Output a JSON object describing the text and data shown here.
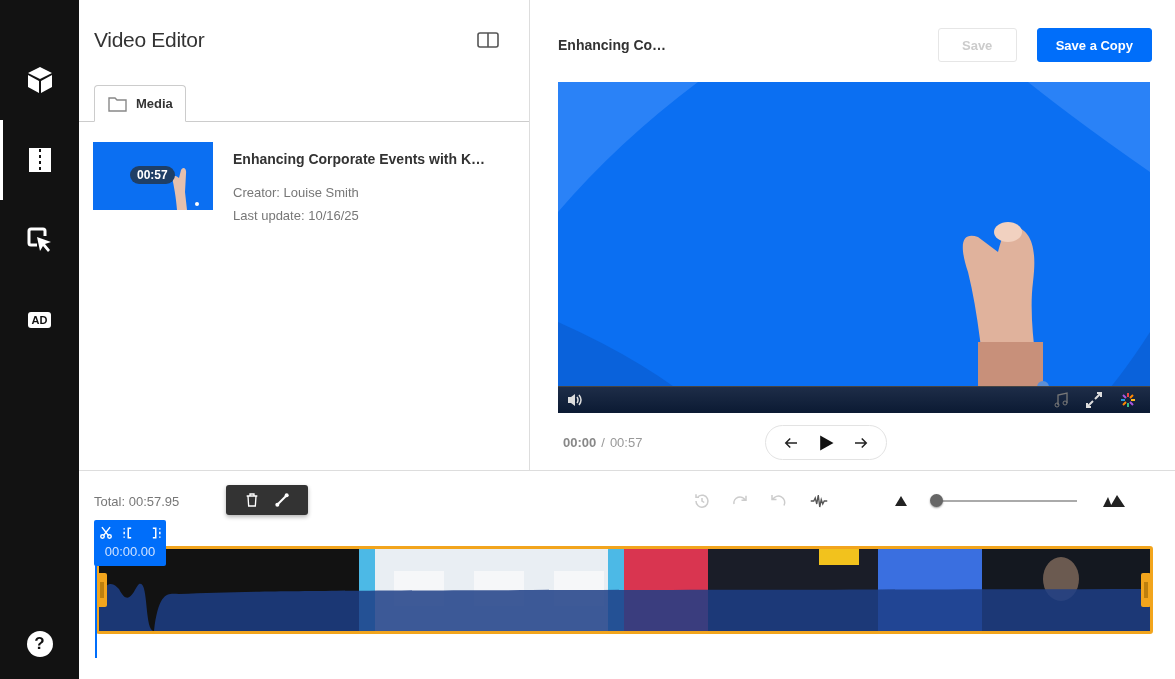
{
  "sidebar": {
    "items": [
      {
        "kind": "cube",
        "selected": false
      },
      {
        "kind": "split",
        "selected": true
      },
      {
        "kind": "cursor",
        "selected": false
      },
      {
        "kind": "badge",
        "label": "AD",
        "selected": false
      }
    ],
    "help": "?"
  },
  "library": {
    "title": "Video Editor",
    "tabs": [
      {
        "label": "Media",
        "selected": true
      }
    ],
    "media": [
      {
        "duration": "00:57",
        "title": "Enhancing Corporate Events with K…",
        "creator": "Creator: Louise Smith",
        "updated": "Last update: 10/16/25"
      }
    ]
  },
  "player": {
    "title": "Enhancing Co…",
    "buttons": [
      {
        "label": "Save",
        "disabled": true
      },
      {
        "label": "Save a Copy",
        "disabled": false
      }
    ],
    "current_time": "00:00",
    "separator": "/",
    "duration": "00:57"
  },
  "timeline": {
    "total": "Total: 00:57.95",
    "zoom": {
      "level": 0.03
    },
    "playhead_time": "00:00.00"
  }
}
